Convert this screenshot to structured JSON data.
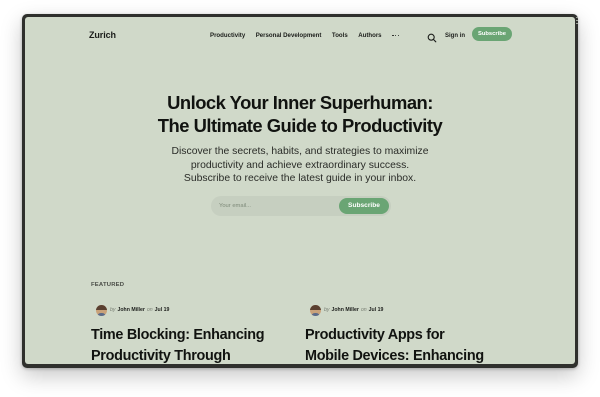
{
  "nav": {
    "logo": "Zurich",
    "menu": [
      "Productivity",
      "Personal Development",
      "Tools",
      "Authors"
    ],
    "more_icon": "more-horizontal-icon",
    "search_icon": "search-icon",
    "signin_label": "Sign in",
    "subscribe_label": "Subscribe"
  },
  "hero": {
    "title_line1": "Unlock Your Inner Superhuman:",
    "title_line2": "The Ultimate Guide to Productivity",
    "subtitle_line1": "Discover the secrets, habits, and strategies to maximize",
    "subtitle_line2": "productivity and achieve extraordinary success.",
    "subtitle_line3": "Subscribe to receive the latest guide in your inbox.",
    "email_placeholder": "Your email...",
    "subscribe_label": "Subscribe"
  },
  "featured": {
    "label": "FEATURED",
    "posts": [
      {
        "by": "by",
        "author": "John Miller",
        "on": "on",
        "date": "Jul 19",
        "title_line1": "Time Blocking: Enhancing",
        "title_line2": "Productivity Through"
      },
      {
        "by": "by",
        "author": "John Miller",
        "on": "on",
        "date": "Jul 19",
        "title_line1": "Productivity Apps for",
        "title_line2": "Mobile Devices: Enhancing"
      }
    ]
  },
  "colors": {
    "background": "#d0d9c9",
    "accent": "#6aa574",
    "text": "#111310",
    "frame": "#2f302d"
  }
}
